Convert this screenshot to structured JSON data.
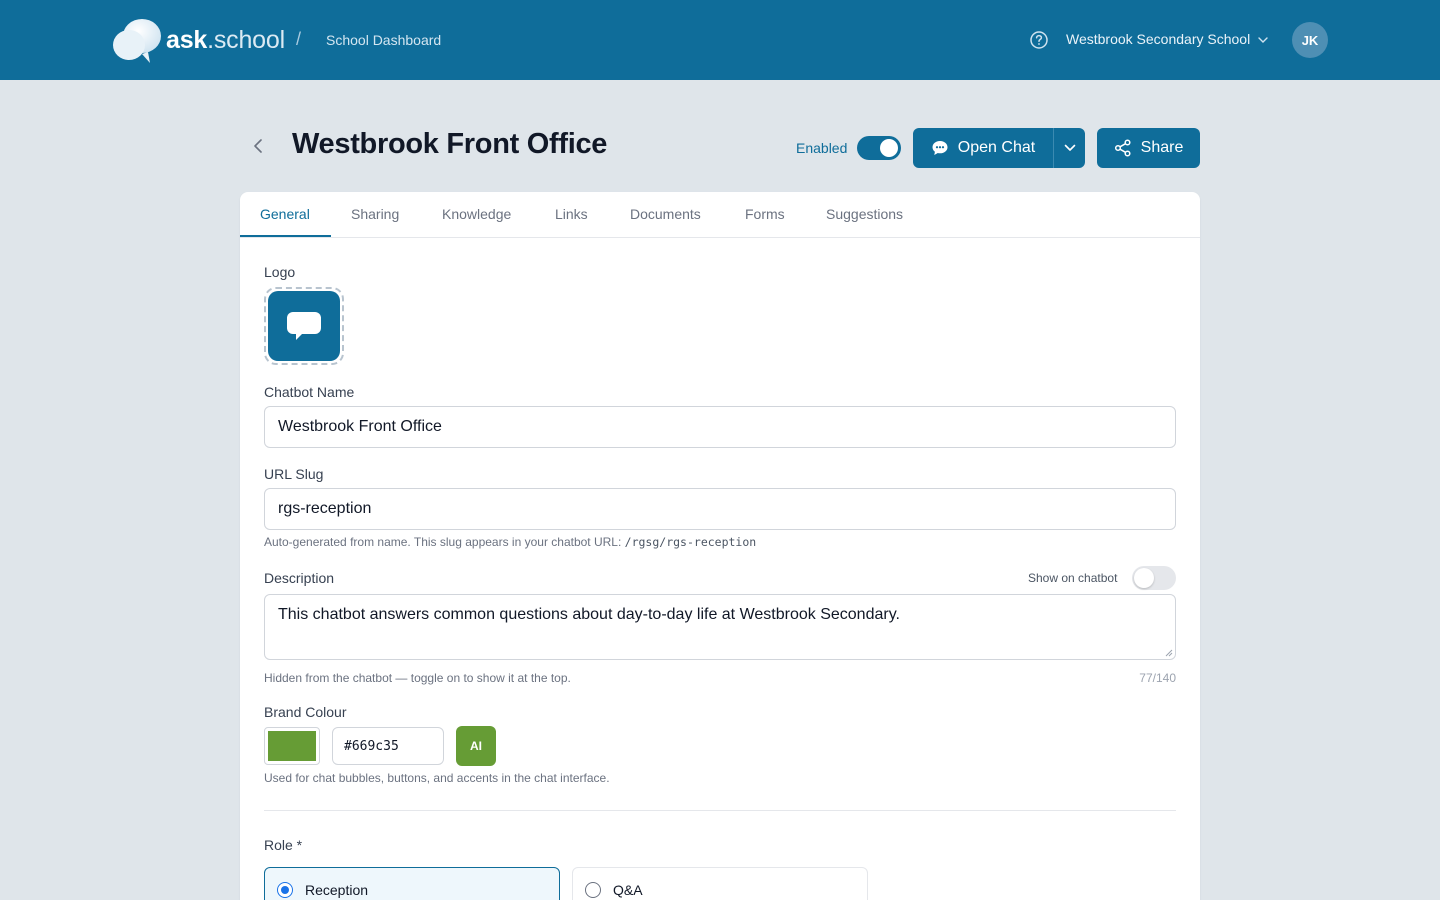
{
  "header": {
    "brand_ask": "ask",
    "brand_school": ".school",
    "breadcrumb_sep": "/",
    "breadcrumb": "School Dashboard",
    "help_icon": "question-circle-icon",
    "school_name": "Westbrook Secondary School",
    "avatar_initials": "JK"
  },
  "page": {
    "title": "Westbrook Front Office",
    "enabled_label": "Enabled",
    "enabled": true,
    "open_chat_label": "Open Chat",
    "share_label": "Share"
  },
  "tabs": [
    {
      "label": "General",
      "active": true
    },
    {
      "label": "Sharing"
    },
    {
      "label": "Knowledge"
    },
    {
      "label": "Links"
    },
    {
      "label": "Documents"
    },
    {
      "label": "Forms"
    },
    {
      "label": "Suggestions"
    }
  ],
  "form": {
    "logo_label": "Logo",
    "name_label": "Chatbot Name",
    "name_value": "Westbrook Front Office",
    "slug_label": "URL Slug",
    "slug_value": "rgs-reception",
    "slug_hint": "Auto-generated from name. This slug appears in your chatbot URL:",
    "slug_url": "/rgsg/rgs-reception",
    "description_label": "Description",
    "show_on_chatbot_label": "Show on chatbot",
    "show_on_chatbot": false,
    "description_value": "This chatbot answers common questions about day-to-day life at Westbrook Secondary.",
    "description_hint": "Hidden from the chatbot — toggle on to show it at the top.",
    "description_counter": "77/140",
    "brand_colour_label": "Brand Colour",
    "brand_colour_hex": "#669c35",
    "ai_label": "AI",
    "brand_colour_hint": "Used for chat bubbles, buttons, and accents in the chat interface.",
    "role_label": "Role *",
    "roles": [
      {
        "label": "Reception",
        "selected": true
      },
      {
        "label": "Q&A",
        "selected": false
      }
    ]
  },
  "colors": {
    "primary": "#0f6d9a",
    "brand_green": "#669c35",
    "background": "#dfe5ea"
  }
}
